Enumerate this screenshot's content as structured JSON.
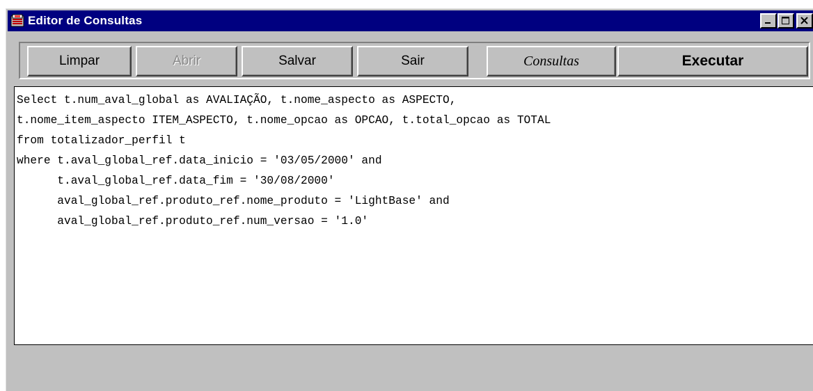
{
  "window": {
    "title": "Editor de Consultas",
    "controls": {
      "minimize_icon": "minimize-icon",
      "maximize_icon": "maximize-icon",
      "close_icon": "close-icon"
    },
    "colors": {
      "titlebar": "#000080",
      "face": "#c0c0c0"
    }
  },
  "toolbar": {
    "limpar_label": "Limpar",
    "abrir_label": "Abrir",
    "salvar_label": "Salvar",
    "sair_label": "Sair",
    "consultas_label": "Consultas",
    "executar_label": "Executar"
  },
  "editor": {
    "lines": [
      "Select t.num_aval_global as AVALIAÇÃO, t.nome_aspecto as ASPECTO,",
      "t.nome_item_aspecto ITEM_ASPECTO, t.nome_opcao as OPCAO, t.total_opcao as TOTAL",
      "from totalizador_perfil t",
      "where t.aval_global_ref.data_inicio = '03/05/2000' and",
      "      t.aval_global_ref.data_fim = '30/08/2000'",
      "      aval_global_ref.produto_ref.nome_produto = 'LightBase' and",
      "      aval_global_ref.produto_ref.num_versao = '1.0'"
    ]
  }
}
